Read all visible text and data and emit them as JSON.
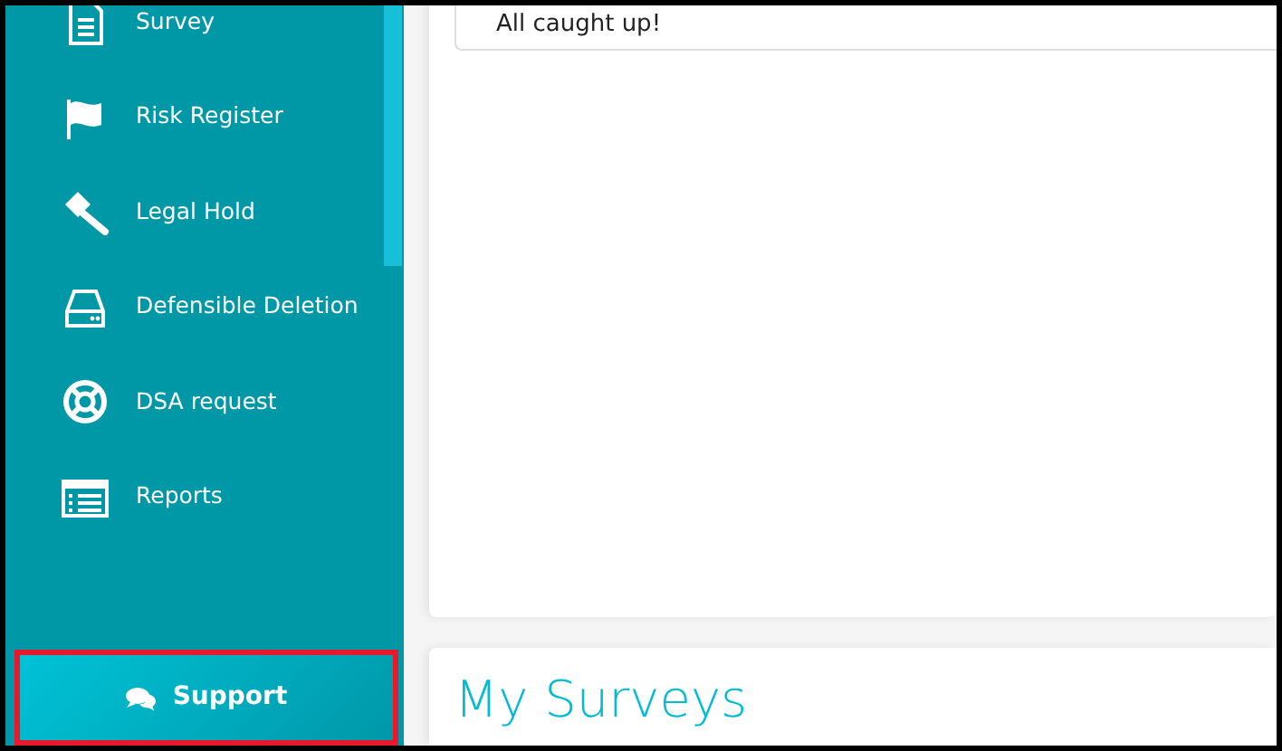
{
  "sidebar": {
    "items": [
      {
        "label": "Survey"
      },
      {
        "label": "Risk Register"
      },
      {
        "label": "Legal Hold"
      },
      {
        "label": "Defensible Deletion"
      },
      {
        "label": "DSA request"
      },
      {
        "label": "Reports"
      }
    ],
    "support_button": {
      "label": "Support",
      "highlighted": true
    }
  },
  "notifications": {
    "message": "All caught up!"
  },
  "surveys_panel": {
    "title": "My Surveys"
  }
}
